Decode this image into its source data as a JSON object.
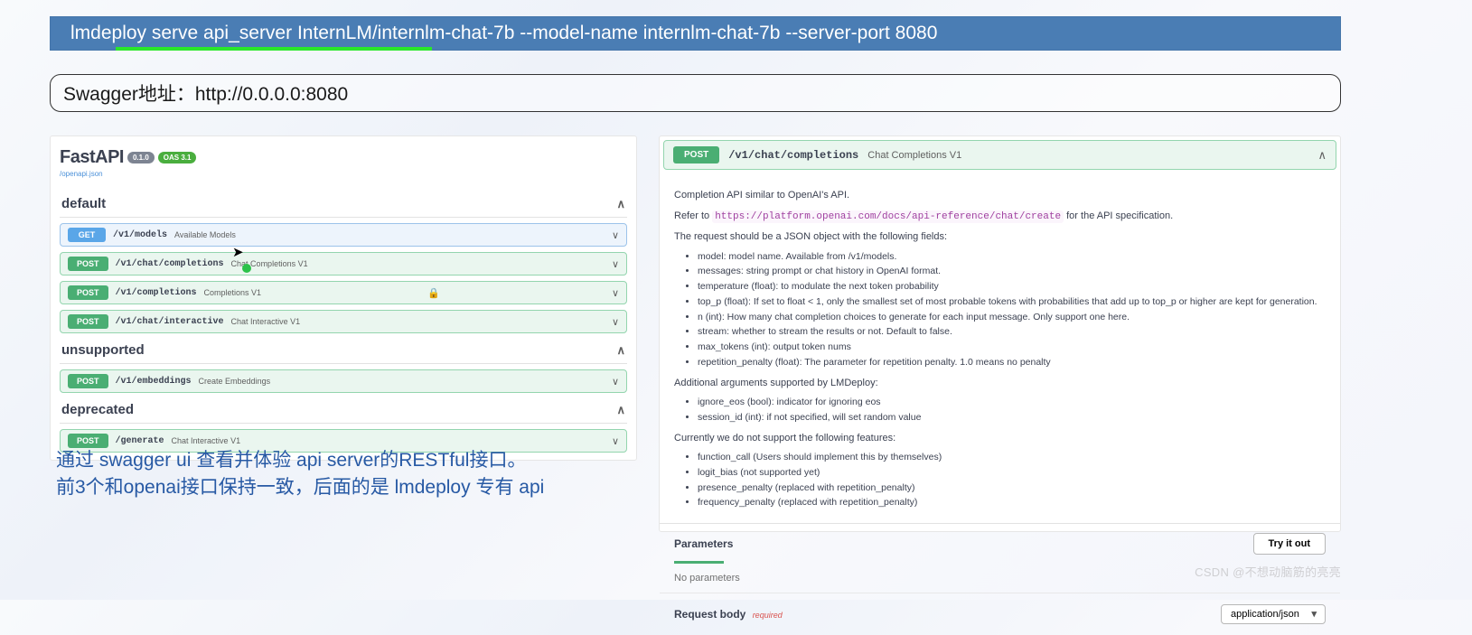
{
  "command": "lmdeploy serve api_server InternLM/internlm-chat-7b --model-name internlm-chat-7b --server-port 8080",
  "address_label": "Swagger地址：http://0.0.0.0:8080",
  "fastapi": {
    "title": "FastAPI",
    "version_badge": "0.1.0",
    "oas_badge": "OAS 3.1",
    "openapi_link": "/openapi.json"
  },
  "sections": [
    {
      "name": "default",
      "open": true,
      "endpoints": [
        {
          "method": "GET",
          "path": "/v1/models",
          "summary": "Available Models"
        },
        {
          "method": "POST",
          "path": "/v1/chat/completions",
          "summary": "Chat Completions V1"
        },
        {
          "method": "POST",
          "path": "/v1/completions",
          "summary": "Completions V1",
          "locked": true
        },
        {
          "method": "POST",
          "path": "/v1/chat/interactive",
          "summary": "Chat Interactive V1"
        }
      ]
    },
    {
      "name": "unsupported",
      "open": true,
      "endpoints": [
        {
          "method": "POST",
          "path": "/v1/embeddings",
          "summary": "Create Embeddings"
        }
      ]
    },
    {
      "name": "deprecated",
      "open": true,
      "endpoints": [
        {
          "method": "POST",
          "path": "/generate",
          "summary": "Chat Interactive V1"
        }
      ]
    }
  ],
  "note_line1": "通过 swagger ui 查看并体验 api server的RESTful接口。",
  "note_line2": "前3个和openai接口保持一致，后面的是 lmdeploy 专有 api",
  "detail": {
    "method": "POST",
    "path": "/v1/chat/completions",
    "summary": "Chat Completions V1",
    "intro": "Completion API similar to OpenAI's API.",
    "refer_prefix": "Refer to ",
    "refer_link": "https://platform.openai.com/docs/api-reference/chat/create",
    "refer_suffix": " for the API specification.",
    "req_intro": "The request should be a JSON object with the following fields:",
    "fields": [
      "model: model name. Available from /v1/models.",
      "messages: string prompt or chat history in OpenAI format.",
      "temperature (float): to modulate the next token probability",
      "top_p (float): If set to float < 1, only the smallest set of most probable tokens with probabilities that add up to top_p or higher are kept for generation.",
      "n (int): How many chat completion choices to generate for each input message. Only support one here.",
      "stream: whether to stream the results or not. Default to false.",
      "max_tokens (int): output token nums",
      "repetition_penalty (float): The parameter for repetition penalty. 1.0 means no penalty"
    ],
    "addl_intro": "Additional arguments supported by LMDeploy:",
    "addl": [
      "ignore_eos (bool): indicator for ignoring eos",
      "session_id (int): if not specified, will set random value"
    ],
    "unsup_intro": "Currently we do not support the following features:",
    "unsup": [
      "function_call (Users should implement this by themselves)",
      "logit_bias (not supported yet)",
      "presence_penalty (replaced with repetition_penalty)",
      "frequency_penalty (replaced with repetition_penalty)"
    ],
    "params_label": "Parameters",
    "try_label": "Try it out",
    "no_params": "No parameters",
    "body_label": "Request body",
    "required_tag": "required",
    "content_type": "application/json"
  },
  "watermark": "CSDN @不想动脑筋的亮亮"
}
